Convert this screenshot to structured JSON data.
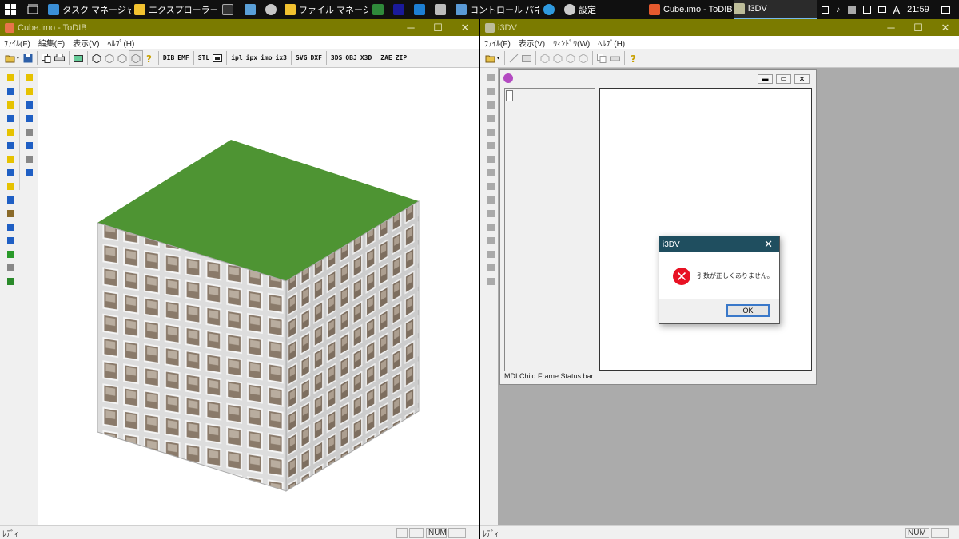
{
  "taskbar": {
    "items": [
      {
        "label": "タスク マネージャー"
      },
      {
        "label": "エクスプローラー"
      },
      {
        "label": "ファイル マネージャー -..."
      },
      {
        "label": "コントロール パネル¥..."
      },
      {
        "label": "設定"
      },
      {
        "label": "Cube.imo - ToDIB"
      },
      {
        "label": "i3DV"
      }
    ],
    "ime": "A",
    "clock": "21:59"
  },
  "todib": {
    "title": "Cube.imo - ToDIB",
    "menu": [
      "ﾌｧｲﾙ(F)",
      "編集(E)",
      "表示(V)",
      "ﾍﾙﾌﾟ(H)"
    ],
    "toolbar_text": [
      "DIB",
      "EMF",
      "STL",
      "ipl",
      "ipx",
      "imo",
      "ix3",
      "SVG",
      "DXF",
      "3DS",
      "OBJ",
      "X3D",
      "ZAE",
      "ZIP"
    ],
    "status_left": "ﾚﾃﾞｨ",
    "status_num": "NUM",
    "cube_top_color": "#4e9433",
    "cube_tile_color": "#8a7a6a"
  },
  "i3dv": {
    "title": "i3DV",
    "menu": [
      "ﾌｧｲﾙ(F)",
      "表示(V)",
      "ｳｨﾝﾄﾞｳ(W)",
      "ﾍﾙﾌﾟ(H)"
    ],
    "child_status": "MDI Child Frame Status bar..",
    "status_left": "ﾚﾃﾞｨ",
    "status_num": "NUM"
  },
  "dialog": {
    "title": "i3DV",
    "message": "引数が正しくありません。",
    "ok_label": "OK",
    "error_color": "#e81123"
  }
}
